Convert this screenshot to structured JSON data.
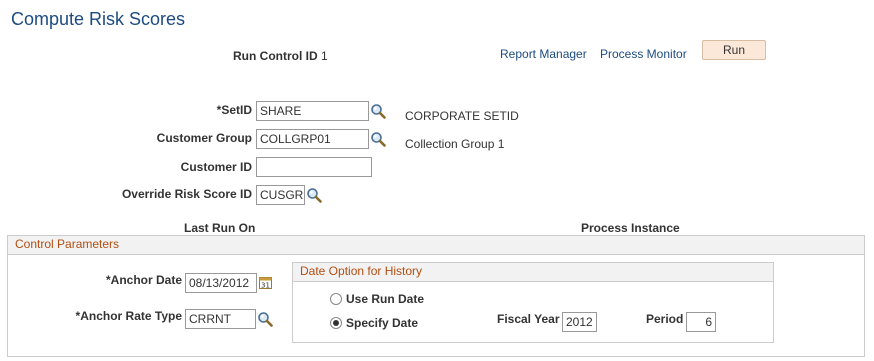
{
  "page": {
    "title": "Compute Risk Scores"
  },
  "run_control": {
    "label": "Run Control ID",
    "value": "1"
  },
  "links": {
    "report_manager": "Report Manager",
    "process_monitor": "Process Monitor"
  },
  "run_button": "Run",
  "setid": {
    "label": "*SetID",
    "value": "SHARE",
    "description": "CORPORATE SETID"
  },
  "customer_group": {
    "label": "Customer Group",
    "value": "COLLGRP01",
    "description": "Collection Group 1"
  },
  "customer_id": {
    "label": "Customer ID",
    "value": ""
  },
  "override_risk": {
    "label": "Override Risk Score ID",
    "value": "CUSGR"
  },
  "last_run_on": {
    "label": "Last Run On"
  },
  "process_instance": {
    "label": "Process Instance"
  },
  "control_parameters": {
    "title": "Control Parameters",
    "anchor_date": {
      "label": "*Anchor Date",
      "value": "08/13/2012"
    },
    "anchor_rate_type": {
      "label": "*Anchor Rate Type",
      "value": "CRRNT"
    }
  },
  "date_option": {
    "title": "Date Option for History",
    "use_run_date": {
      "label": "Use Run Date",
      "selected": false
    },
    "specify_date": {
      "label": "Specify Date",
      "selected": true
    },
    "fiscal_year": {
      "label": "Fiscal Year",
      "value": "2012"
    },
    "period": {
      "label": "Period",
      "value": "6"
    }
  },
  "icons": {
    "lookup": "magnifier-lookup-icon",
    "calendar": "calendar-icon"
  },
  "colors": {
    "title": "#1c4b80",
    "link": "#1c4b80",
    "group_title": "#b24e12",
    "run_button_bg": "#fce8d8"
  }
}
